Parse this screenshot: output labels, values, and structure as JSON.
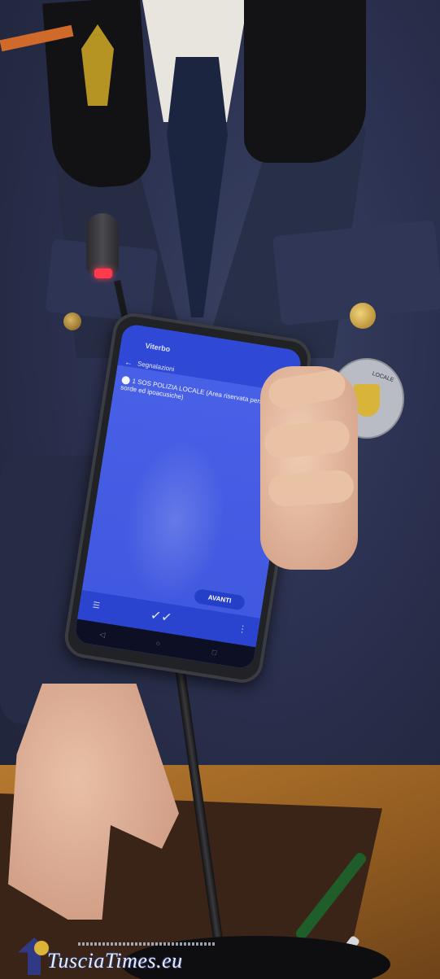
{
  "phone_app": {
    "title": "Viterbo",
    "back_icon": "arrow-left-icon",
    "section_label": "Segnalazioni",
    "option_text": "1 SOS POLIZIA LOCALE (Area riservata persone sorde ed ipoacusiche)",
    "next_button_label": "AVANTI",
    "bottom_bar_icons": [
      "menu-icon",
      "app-logo-icon",
      "more-vertical-icon"
    ]
  },
  "patch": {
    "text": "LOCALE"
  },
  "watermark": {
    "text": "TusciaTimes.eu"
  },
  "colors": {
    "app_blue": "#3f57de",
    "button_blue": "#2440c8",
    "mic_led_red": "#ff3a4a",
    "pen_green": "#1f5e2a"
  }
}
